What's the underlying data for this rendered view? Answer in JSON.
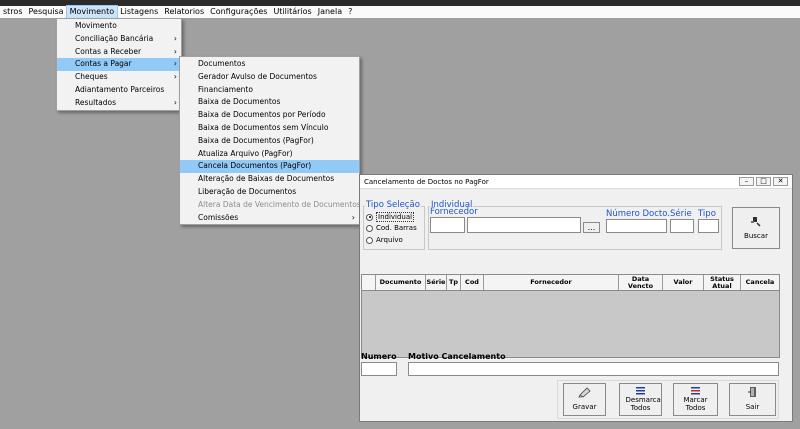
{
  "menubar": {
    "items": [
      "stros",
      "Pesquisa",
      "Movimento",
      "Listagens",
      "Relatorios",
      "Configurações",
      "Utilitários",
      "Janela",
      "?"
    ]
  },
  "movimento_menu": {
    "items": [
      {
        "label": "Movimento",
        "submenu": false
      },
      {
        "label": "Conciliação Bancária",
        "submenu": true
      },
      {
        "label": "Contas a Receber",
        "submenu": true
      },
      {
        "label": "Contas a Pagar",
        "submenu": true,
        "selected": true
      },
      {
        "label": "Cheques",
        "submenu": true
      },
      {
        "label": "Adiantamento Parceiros",
        "submenu": false
      },
      {
        "label": "Resultados",
        "submenu": true
      }
    ]
  },
  "contas_pagar_menu": {
    "items": [
      {
        "label": "Documentos"
      },
      {
        "label": "Gerador Avulso de Documentos"
      },
      {
        "label": "Financiamento"
      },
      {
        "label": "Baixa de Documentos"
      },
      {
        "label": "Baixa de Documentos por Período"
      },
      {
        "label": "Baixa de Documentos sem Vínculo"
      },
      {
        "label": "Baixa de Documentos (PagFor)"
      },
      {
        "label": "Atualiza Arquivo (PagFor)"
      },
      {
        "label": "Cancela Documentos (PagFor)",
        "selected": true
      },
      {
        "label": "Alteração de Baixas de Documentos"
      },
      {
        "label": "Liberação de Documentos"
      },
      {
        "label": "Altera Data de Vencimento de Documentos",
        "disabled": true
      },
      {
        "label": "Comissões",
        "submenu": true
      }
    ]
  },
  "dialog": {
    "title": "Cancelamento de Doctos no PagFor",
    "tipo_selecao": {
      "title": "Tipo Seleção",
      "options": [
        "Individual",
        "Cod. Barras",
        "Arquivo"
      ],
      "selected": "Individual"
    },
    "individual": {
      "title": "Individual",
      "fornecedor_label": "Fornecedor",
      "ellipsis": "...",
      "numero_docto_label": "Número Docto.",
      "serie_label": "Série",
      "tipo_label": "Tipo"
    },
    "buscar_label": "Buscar",
    "grid": {
      "columns": [
        "",
        "Documento",
        "Série",
        "Tp",
        "Cod",
        "Fornecedor",
        "Data Vencto",
        "Valor",
        "Status Atual",
        "Cancela"
      ]
    },
    "numero_label": "Numero",
    "motivo_label": "Motivo Cancelamento",
    "buttons": {
      "gravar": "Gravar",
      "desmarca": "Desmarca Todos",
      "marcar": "Marcar Todos",
      "sair": "Sair"
    }
  }
}
